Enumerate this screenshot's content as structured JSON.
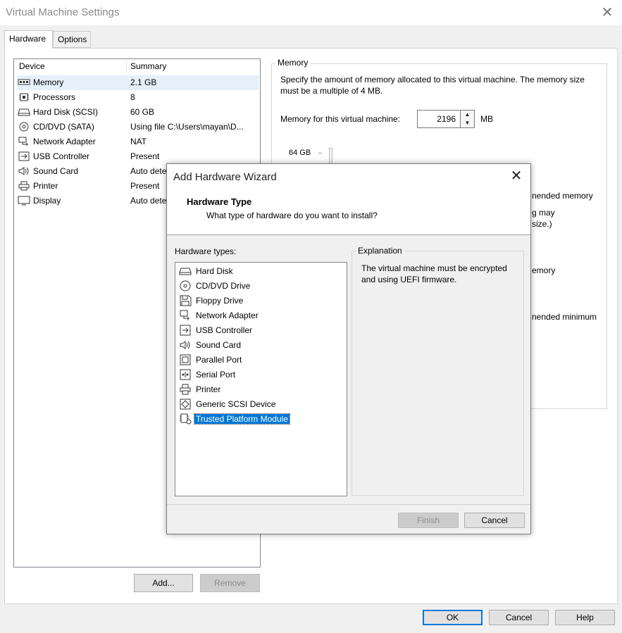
{
  "window": {
    "title": "Virtual Machine Settings"
  },
  "tabs": [
    {
      "label": "Hardware"
    },
    {
      "label": "Options"
    }
  ],
  "device_table": {
    "headers": {
      "device": "Device",
      "summary": "Summary"
    },
    "rows": [
      {
        "device": "Memory",
        "summary": "2.1 GB",
        "icon": "memory-icon"
      },
      {
        "device": "Processors",
        "summary": "8",
        "icon": "processor-icon"
      },
      {
        "device": "Hard Disk (SCSI)",
        "summary": "60 GB",
        "icon": "hard-disk-icon"
      },
      {
        "device": "CD/DVD (SATA)",
        "summary": "Using file C:\\Users\\mayan\\D...",
        "icon": "cd-dvd-icon"
      },
      {
        "device": "Network Adapter",
        "summary": "NAT",
        "icon": "network-adapter-icon"
      },
      {
        "device": "USB Controller",
        "summary": "Present",
        "icon": "usb-icon"
      },
      {
        "device": "Sound Card",
        "summary": "Auto dete",
        "icon": "speaker-icon"
      },
      {
        "device": "Printer",
        "summary": "Present",
        "icon": "printer-icon"
      },
      {
        "device": "Display",
        "summary": "Auto dete",
        "icon": "monitor-icon"
      }
    ]
  },
  "device_buttons": {
    "add": "Add...",
    "remove": "Remove"
  },
  "memory": {
    "group_label": "Memory",
    "description": "Specify the amount of memory allocated to this virtual machine. The memory size must be a multiple of 4 MB.",
    "field_label": "Memory for this virtual machine:",
    "value": "2196",
    "unit": "MB",
    "scale_top": "64 GB",
    "partial_1": "nended memory",
    "partial_2": "g may",
    "partial_3": "size.)",
    "partial_4": "emory",
    "partial_5": "nended minimum"
  },
  "footer": {
    "ok": "OK",
    "cancel": "Cancel",
    "help": "Help"
  },
  "wizard": {
    "title": "Add Hardware Wizard",
    "heading": "Hardware Type",
    "subheading": "What type of hardware do you want to install?",
    "types_label": "Hardware types:",
    "types": [
      {
        "label": "Hard Disk",
        "icon": "hard-disk-icon"
      },
      {
        "label": "CD/DVD Drive",
        "icon": "cd-dvd-icon"
      },
      {
        "label": "Floppy Drive",
        "icon": "floppy-icon"
      },
      {
        "label": "Network Adapter",
        "icon": "network-adapter-icon"
      },
      {
        "label": "USB Controller",
        "icon": "usb-icon"
      },
      {
        "label": "Sound Card",
        "icon": "speaker-icon"
      },
      {
        "label": "Parallel Port",
        "icon": "parallel-port-icon"
      },
      {
        "label": "Serial Port",
        "icon": "serial-port-icon"
      },
      {
        "label": "Printer",
        "icon": "printer-icon"
      },
      {
        "label": "Generic SCSI Device",
        "icon": "scsi-icon"
      },
      {
        "label": "Trusted Platform Module",
        "icon": "tpm-icon",
        "selected": true
      }
    ],
    "explanation_label": "Explanation",
    "explanation": "The virtual machine must be encrypted and using UEFI firmware.",
    "finish": "Finish",
    "cancel": "Cancel"
  },
  "colors": {
    "accent": "#0078d7",
    "selection_bg": "#e6f0fa",
    "panel": "#ffffff",
    "chrome": "#f0f0f0"
  }
}
